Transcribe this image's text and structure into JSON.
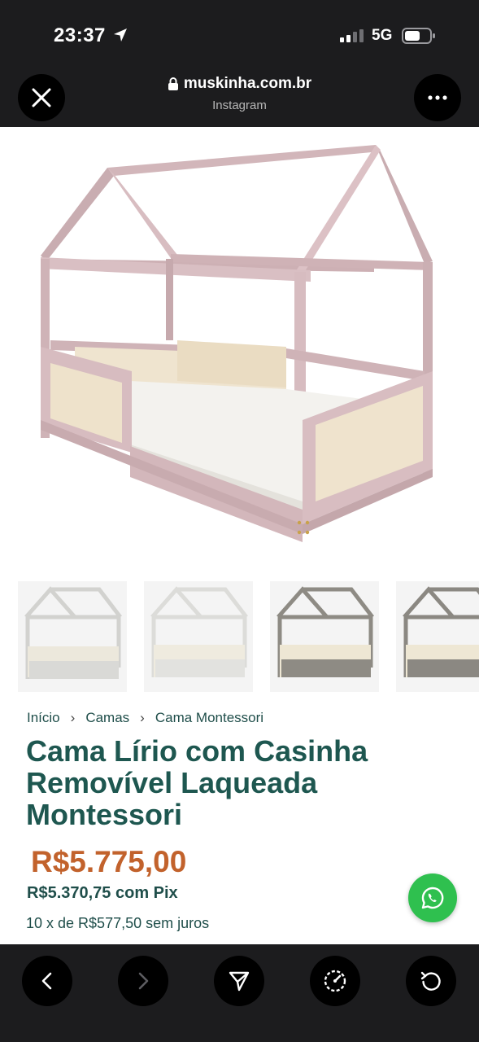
{
  "status_bar": {
    "time": "23:37",
    "network": "5G"
  },
  "browser": {
    "domain": "muskinha.com.br",
    "source": "Instagram"
  },
  "breadcrumb": {
    "items": [
      "Início",
      "Camas",
      "Cama Montessori"
    ],
    "separator": "›"
  },
  "product": {
    "title": "Cama Lírio com Casinha Removível Laqueada Montessori",
    "price": "R$5.775,00",
    "pix_price": "R$5.370,75 com Pix",
    "installments": "10 x de R$577,50 sem juros"
  },
  "thumbnails": [
    {
      "label": "white-variant",
      "color": "#d8d8d6"
    },
    {
      "label": "white-variant-alt",
      "color": "#e2e2df"
    },
    {
      "label": "gray-variant",
      "color": "#8e8b84"
    },
    {
      "label": "gray-variant-partial",
      "color": "#8b8882"
    }
  ],
  "colors": {
    "bar": "#1c1c1e",
    "accent": "#1e5750",
    "price": "#c2622c",
    "whatsapp": "#2fc04f",
    "bed": "#d5b9bd"
  },
  "icons": [
    "close-icon",
    "lock-icon",
    "more-icon",
    "whatsapp-icon",
    "back-icon",
    "forward-icon",
    "share-icon",
    "speed-icon",
    "reload-icon"
  ]
}
